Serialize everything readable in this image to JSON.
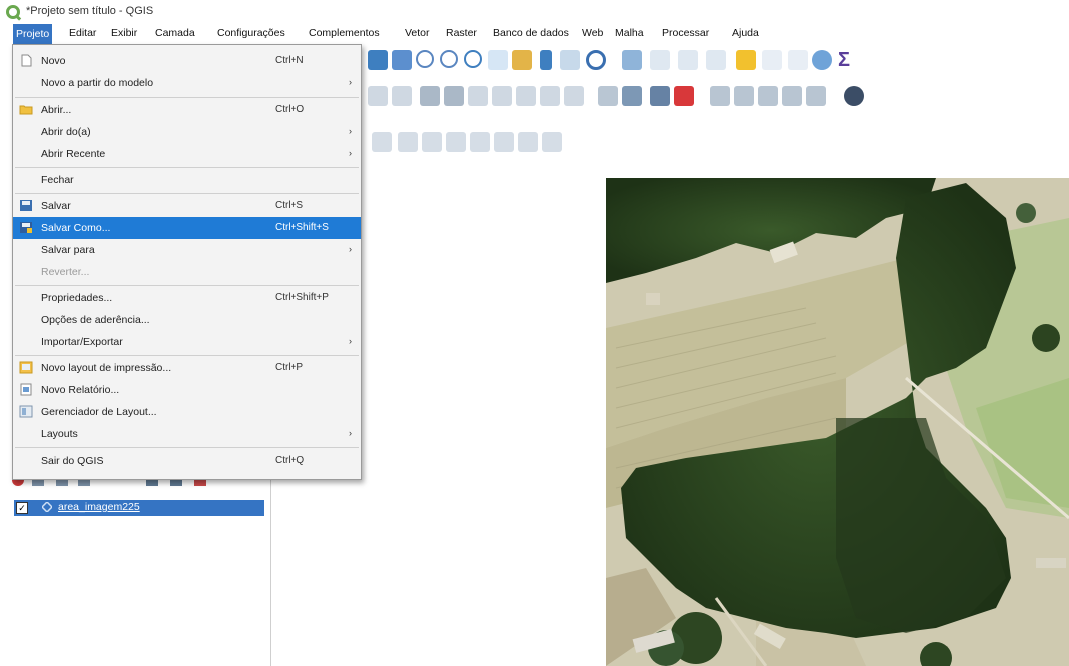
{
  "window": {
    "title": "*Projeto sem título - QGIS"
  },
  "menubar": [
    {
      "label": "Projeto",
      "active": true
    },
    {
      "label": "Editar"
    },
    {
      "label": "Exibir"
    },
    {
      "label": "Camada"
    },
    {
      "label": "Configurações"
    },
    {
      "label": "Complementos"
    },
    {
      "label": "Vetor"
    },
    {
      "label": "Raster"
    },
    {
      "label": "Banco de dados"
    },
    {
      "label": "Web"
    },
    {
      "label": "Malha"
    },
    {
      "label": "Processar"
    },
    {
      "label": "Ajuda"
    }
  ],
  "project_menu": {
    "items": [
      {
        "label": "Novo",
        "shortcut": "Ctrl+N",
        "icon": "new-file-icon"
      },
      {
        "label": "Novo a partir do modelo",
        "submenu": true
      },
      {
        "label": "Abrir...",
        "shortcut": "Ctrl+O",
        "icon": "folder-open-icon"
      },
      {
        "label": "Abrir do(a)",
        "submenu": true
      },
      {
        "label": "Abrir Recente",
        "submenu": true
      },
      {
        "label": "Fechar"
      },
      {
        "label": "Salvar",
        "shortcut": "Ctrl+S",
        "icon": "save-icon"
      },
      {
        "label": "Salvar Como...",
        "shortcut": "Ctrl+Shift+S",
        "icon": "save-as-icon",
        "highlighted": true
      },
      {
        "label": "Salvar para",
        "submenu": true
      },
      {
        "label": "Reverter...",
        "disabled": true
      },
      {
        "label": "Propriedades...",
        "shortcut": "Ctrl+Shift+P"
      },
      {
        "label": "Opções de aderência..."
      },
      {
        "label": "Importar/Exportar",
        "submenu": true
      },
      {
        "label": "Novo layout de impressão...",
        "shortcut": "Ctrl+P",
        "icon": "new-print-layout-icon"
      },
      {
        "label": "Novo Relatório...",
        "icon": "new-report-icon"
      },
      {
        "label": "Gerenciador de Layout...",
        "icon": "layout-manager-icon"
      },
      {
        "label": "Layouts",
        "submenu": true
      },
      {
        "label": "Sair do QGIS",
        "shortcut": "Ctrl+Q"
      }
    ]
  },
  "layers_panel": {
    "layer_name": "area_imagem225",
    "checked": true
  },
  "colors": {
    "accent": "#3574c3",
    "menu_highlight": "#1f7bd6",
    "forest": "#2f4a22"
  }
}
